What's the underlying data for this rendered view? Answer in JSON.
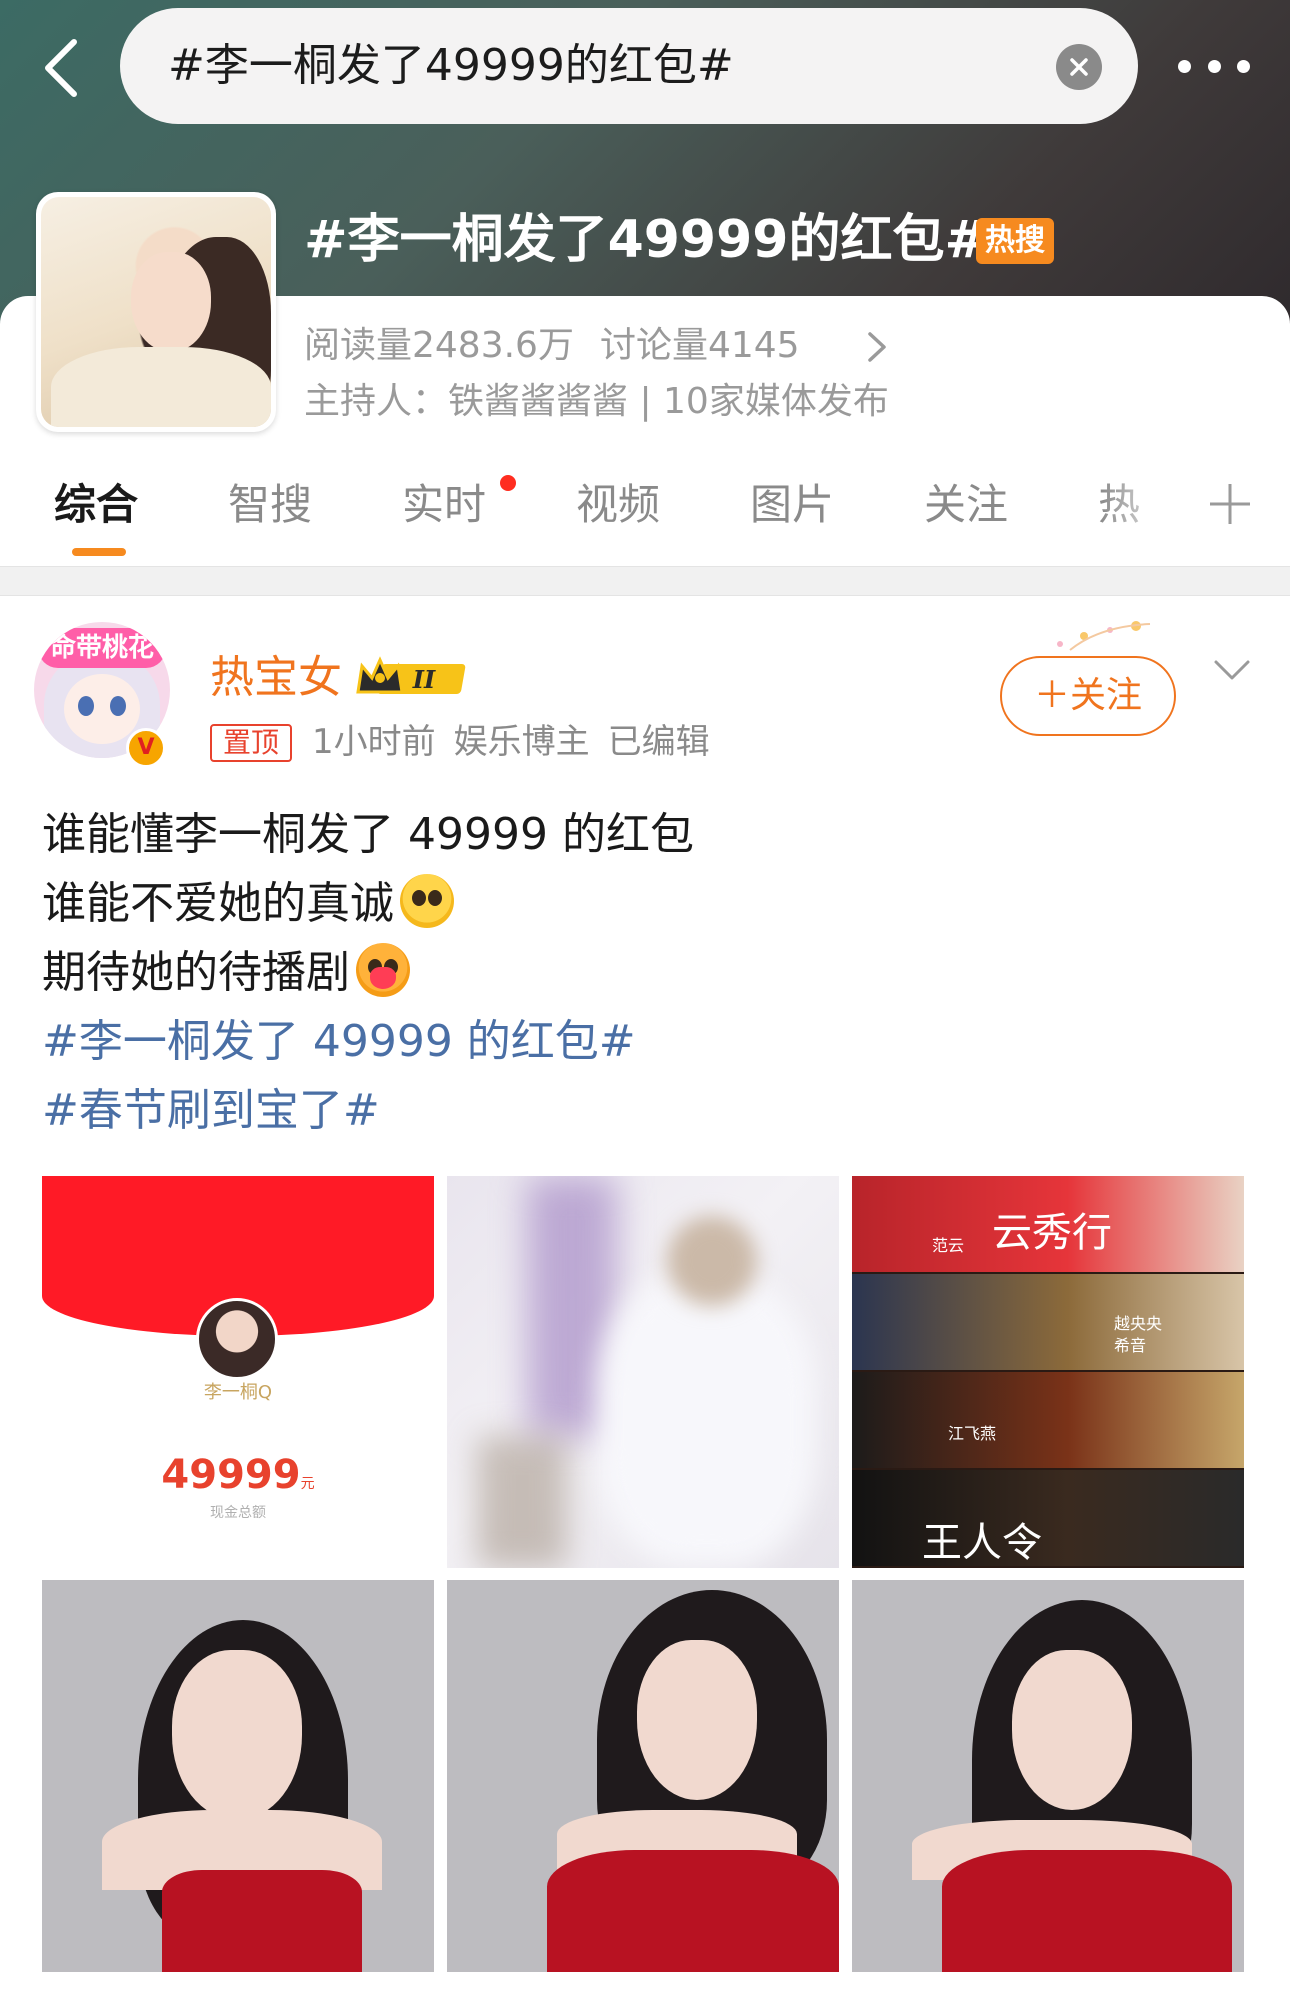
{
  "header": {
    "search_text": "#李一桐发了49999的红包#",
    "topic_title": "#李一桐发了49999的红包#",
    "hot_badge": "热搜",
    "stats_reads": "阅读量2483.6万",
    "stats_discussion": "讨论量4145",
    "host": "主持人：铁酱酱酱酱 | 10家媒体发布"
  },
  "tabs": [
    {
      "label": "综合",
      "active": true
    },
    {
      "label": "智搜",
      "active": false
    },
    {
      "label": "实时",
      "active": false,
      "has_dot": true
    },
    {
      "label": "视频",
      "active": false
    },
    {
      "label": "图片",
      "active": false
    },
    {
      "label": "关注",
      "active": false
    },
    {
      "label": "热",
      "active": false
    }
  ],
  "post": {
    "avatar_banner": "命带桃花",
    "author": "热宝女",
    "member_level": "II",
    "pin_tag": "置顶",
    "time": "1小时前",
    "role": "娱乐博主",
    "edited": "已编辑",
    "follow_label": "＋关注",
    "text_lines": [
      "谁能懂李一桐发了 49999 的红包",
      "谁能不爱她的真诚",
      "期待她的待播剧"
    ],
    "emojis": [
      "pleading-face-emoji",
      "heart-hug-emoji"
    ],
    "hashtags": [
      "#李一桐发了 49999 的红包#",
      "#春节刷到宝了#"
    ]
  },
  "images": {
    "red_packet": {
      "name": "李一桐Q",
      "amount": "49999",
      "unit": "元",
      "label": "现金总额"
    },
    "drama_titles": [
      "云秀行",
      "范云",
      "越央央",
      "希音",
      "江飞燕",
      "王人令"
    ]
  },
  "colors": {
    "accent_orange": "#f0741e",
    "hot_badge": "#f68a1f",
    "hashtag_blue": "#4a6fa5",
    "red_dot": "#ff2d20"
  }
}
